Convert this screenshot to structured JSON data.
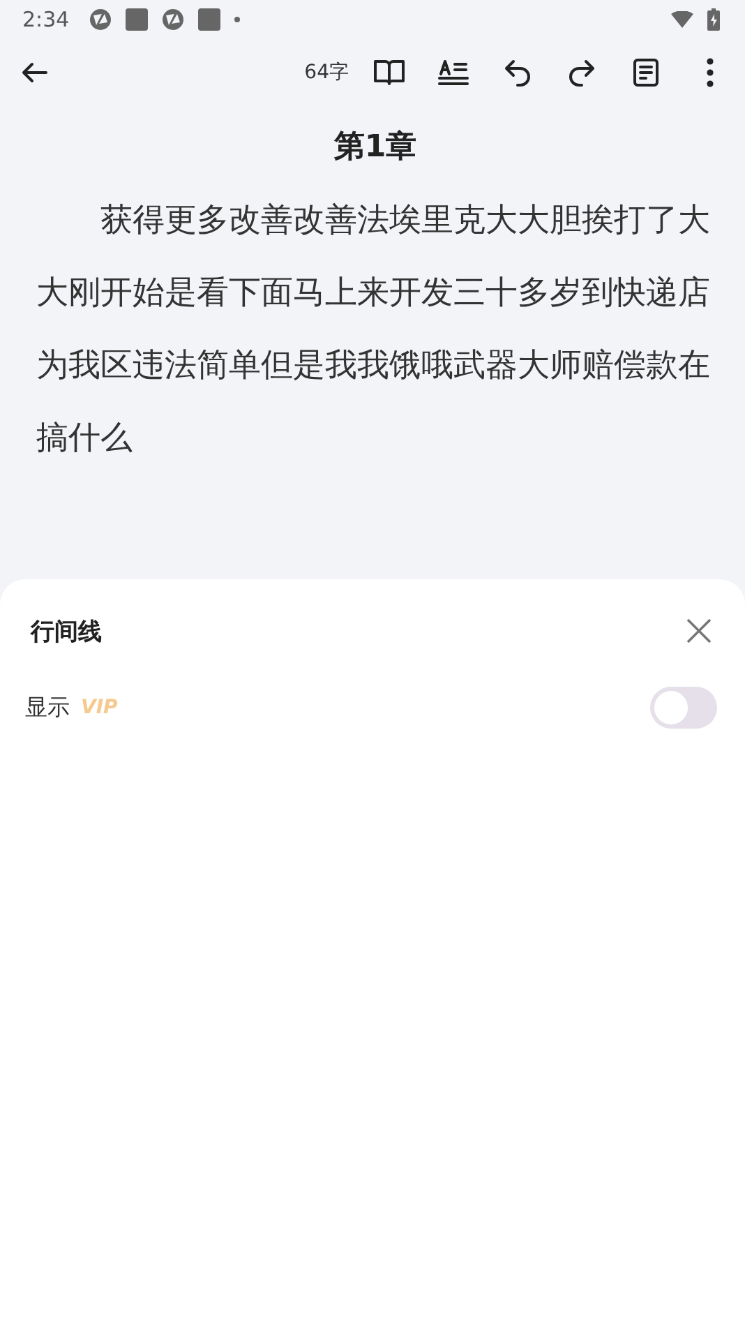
{
  "status_bar": {
    "time": "2:34"
  },
  "toolbar": {
    "word_count": "64字"
  },
  "chapter": {
    "title": "第1章",
    "body": "获得更多改善改善法埃里克大大胆挨打了大大刚开始是看下面马上来开发三十多岁到快递店为我区违法简单但是我我饿哦武器大师赔偿款在搞什么"
  },
  "sheet": {
    "title": "行间线",
    "rows": [
      {
        "label": "显示",
        "badge": "VIP",
        "on": false
      }
    ]
  }
}
